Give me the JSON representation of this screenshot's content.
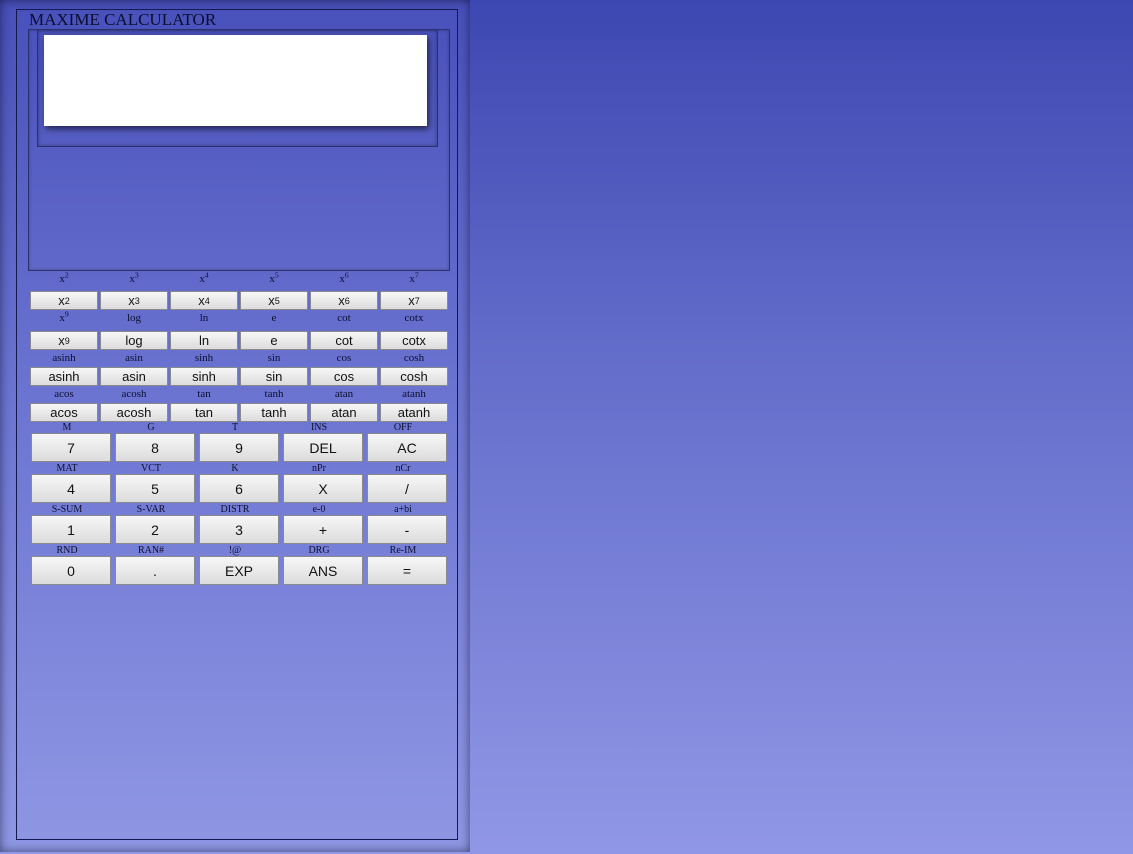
{
  "title": "MAXIME CALCULATOR",
  "display": {
    "value": ""
  },
  "sci_rows": [
    [
      {
        "key": "x2",
        "base": "x",
        "exp": "2",
        "shift": "x",
        "shift_exp": "2"
      },
      {
        "key": "x3",
        "base": "x",
        "exp": "3",
        "shift": "x",
        "shift_exp": "3"
      },
      {
        "key": "x4",
        "base": "x",
        "exp": "4",
        "shift": "x",
        "shift_exp": "4"
      },
      {
        "key": "x5",
        "base": "x",
        "exp": "5",
        "shift": "x",
        "shift_exp": "5"
      },
      {
        "key": "x6",
        "base": "x",
        "exp": "6",
        "shift": "x",
        "shift_exp": "6"
      },
      {
        "key": "x7",
        "base": "x",
        "exp": "7",
        "shift": "x",
        "shift_exp": "7"
      }
    ],
    [
      {
        "key": "x9",
        "base": "x",
        "exp": "9",
        "shift": "x",
        "shift_exp": "9"
      },
      {
        "key": "log",
        "base": "log",
        "exp": "",
        "shift": "log",
        "shift_exp": ""
      },
      {
        "key": "ln",
        "base": "ln",
        "exp": "",
        "shift": "ln",
        "shift_exp": ""
      },
      {
        "key": "e",
        "base": "e",
        "exp": "",
        "shift": "e",
        "shift_exp": ""
      },
      {
        "key": "cot",
        "base": "cot",
        "exp": "",
        "shift": "cot",
        "shift_exp": ""
      },
      {
        "key": "cotx",
        "base": "cotx",
        "exp": "",
        "shift": "cotx",
        "shift_exp": ""
      }
    ],
    [
      {
        "key": "asinh",
        "base": "asinh",
        "exp": "",
        "shift": "asinh",
        "shift_exp": ""
      },
      {
        "key": "asin",
        "base": "asin",
        "exp": "",
        "shift": "asin",
        "shift_exp": ""
      },
      {
        "key": "sinh",
        "base": "sinh",
        "exp": "",
        "shift": "sinh",
        "shift_exp": ""
      },
      {
        "key": "sin",
        "base": "sin",
        "exp": "",
        "shift": "sin",
        "shift_exp": ""
      },
      {
        "key": "cos",
        "base": "cos",
        "exp": "",
        "shift": "cos",
        "shift_exp": ""
      },
      {
        "key": "cosh",
        "base": "cosh",
        "exp": "",
        "shift": "cosh",
        "shift_exp": ""
      }
    ],
    [
      {
        "key": "acos",
        "base": "acos",
        "exp": "",
        "shift": "acos",
        "shift_exp": ""
      },
      {
        "key": "acosh",
        "base": "acosh",
        "exp": "",
        "shift": "acosh",
        "shift_exp": ""
      },
      {
        "key": "tan",
        "base": "tan",
        "exp": "",
        "shift": "tan",
        "shift_exp": ""
      },
      {
        "key": "tanh",
        "base": "tanh",
        "exp": "",
        "shift": "tanh",
        "shift_exp": ""
      },
      {
        "key": "atan",
        "base": "atan",
        "exp": "",
        "shift": "atan",
        "shift_exp": ""
      },
      {
        "key": "atanh",
        "base": "atanh",
        "exp": "",
        "shift": "atanh",
        "shift_exp": ""
      }
    ]
  ],
  "num_rows": [
    [
      {
        "key": "7",
        "label": "7",
        "shift": "M"
      },
      {
        "key": "8",
        "label": "8",
        "shift": "G"
      },
      {
        "key": "9",
        "label": "9",
        "shift": "T"
      },
      {
        "key": "del",
        "label": "DEL",
        "shift": "INS"
      },
      {
        "key": "ac",
        "label": "AC",
        "shift": "OFF"
      }
    ],
    [
      {
        "key": "4",
        "label": "4",
        "shift": "MAT"
      },
      {
        "key": "5",
        "label": "5",
        "shift": "VCT"
      },
      {
        "key": "6",
        "label": "6",
        "shift": "K"
      },
      {
        "key": "multiply",
        "label": "X",
        "shift": "nPr"
      },
      {
        "key": "divide",
        "label": "/",
        "shift": "nCr"
      }
    ],
    [
      {
        "key": "1",
        "label": "1",
        "shift": "S-SUM"
      },
      {
        "key": "2",
        "label": "2",
        "shift": "S-VAR"
      },
      {
        "key": "3",
        "label": "3",
        "shift": "DISTR"
      },
      {
        "key": "plus",
        "label": "+",
        "shift": "e-0"
      },
      {
        "key": "minus",
        "label": "-",
        "shift": "a+bi"
      }
    ],
    [
      {
        "key": "0",
        "label": "0",
        "shift": "RND"
      },
      {
        "key": "dot",
        "label": ".",
        "shift": "RAN#"
      },
      {
        "key": "exp",
        "label": "EXP",
        "shift": "!@"
      },
      {
        "key": "ans",
        "label": "ANS",
        "shift": "DRG"
      },
      {
        "key": "equals",
        "label": "=",
        "shift": "Re-IM"
      }
    ]
  ]
}
